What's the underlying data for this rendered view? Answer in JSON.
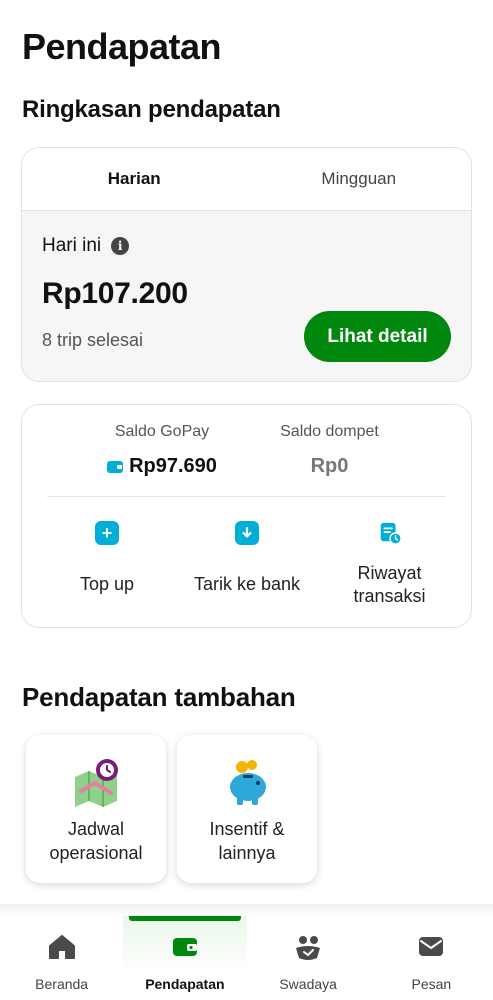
{
  "page": {
    "title": "Pendapatan"
  },
  "summary": {
    "section_title": "Ringkasan pendapatan",
    "tabs": [
      {
        "label": "Harian",
        "active": true
      },
      {
        "label": "Mingguan",
        "active": false
      }
    ],
    "period_label": "Hari ini",
    "amount": "Rp107.200",
    "trips": "8 trip selesai",
    "detail_button": "Lihat detail"
  },
  "balance": {
    "gopay": {
      "label": "Saldo GoPay",
      "value": "Rp97.690",
      "icon": "wallet-icon"
    },
    "dompet": {
      "label": "Saldo dompet",
      "value": "Rp0"
    },
    "actions": [
      {
        "label": "Top up",
        "icon": "plus-icon"
      },
      {
        "label": "Tarik ke bank",
        "icon": "download-icon"
      },
      {
        "label": "Riwayat transaksi",
        "icon": "history-icon"
      }
    ]
  },
  "extra": {
    "section_title": "Pendapatan tambahan",
    "tiles": [
      {
        "label": "Jadwal operasional",
        "icon": "map-clock-icon"
      },
      {
        "label": "Insentif & lainnya",
        "icon": "piggy-bank-icon"
      }
    ]
  },
  "nav": {
    "items": [
      {
        "label": "Beranda",
        "icon": "home-icon",
        "active": false
      },
      {
        "label": "Pendapatan",
        "icon": "wallet-icon",
        "active": true
      },
      {
        "label": "Swadaya",
        "icon": "swadaya-icon",
        "active": false
      },
      {
        "label": "Pesan",
        "icon": "mail-icon",
        "active": false
      }
    ]
  },
  "colors": {
    "primary_green": "#00880e",
    "gopay_blue": "#00aed6"
  }
}
